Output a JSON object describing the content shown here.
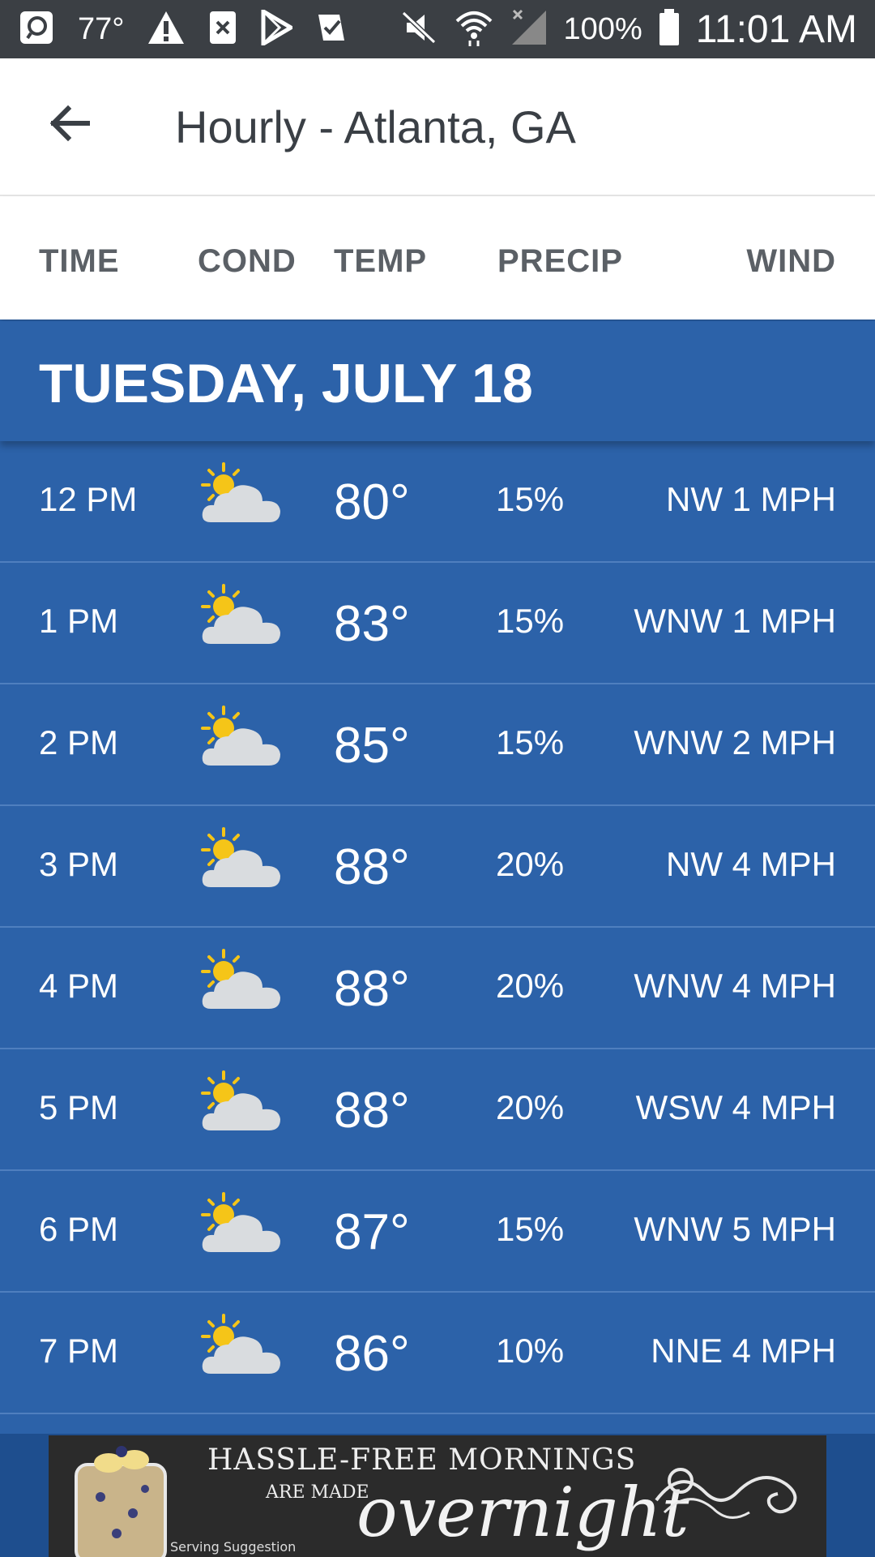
{
  "status_bar": {
    "temperature": "77°",
    "battery": "100%",
    "time": "11:01 AM",
    "icons": [
      "messaging-icon",
      "warning-icon",
      "close-box-icon",
      "play-store-icon",
      "task-check-icon",
      "mute-icon",
      "wifi-icon",
      "signal-icon",
      "battery-icon"
    ]
  },
  "app_bar": {
    "title": "Hourly - Atlanta, GA",
    "back_icon": "arrow-left-icon"
  },
  "columns": {
    "time": "TIME",
    "cond": "COND",
    "temp": "TEMP",
    "precip": "PRECIP",
    "wind": "WIND"
  },
  "day_header": "TUESDAY, JULY 18",
  "rows": [
    {
      "time": "12 PM",
      "cond": "partly-cloudy-icon",
      "temp": "80°",
      "precip": "15%",
      "wind": "NW 1 MPH"
    },
    {
      "time": "1 PM",
      "cond": "partly-cloudy-icon",
      "temp": "83°",
      "precip": "15%",
      "wind": "WNW 1 MPH"
    },
    {
      "time": "2 PM",
      "cond": "partly-cloudy-icon",
      "temp": "85°",
      "precip": "15%",
      "wind": "WNW 2 MPH"
    },
    {
      "time": "3 PM",
      "cond": "partly-cloudy-icon",
      "temp": "88°",
      "precip": "20%",
      "wind": "NW 4 MPH"
    },
    {
      "time": "4 PM",
      "cond": "partly-cloudy-icon",
      "temp": "88°",
      "precip": "20%",
      "wind": "WNW 4 MPH"
    },
    {
      "time": "5 PM",
      "cond": "partly-cloudy-icon",
      "temp": "88°",
      "precip": "20%",
      "wind": "WSW 4 MPH"
    },
    {
      "time": "6 PM",
      "cond": "partly-cloudy-icon",
      "temp": "87°",
      "precip": "15%",
      "wind": "WNW 5 MPH"
    },
    {
      "time": "7 PM",
      "cond": "partly-cloudy-icon",
      "temp": "86°",
      "precip": "10%",
      "wind": "NNE 4 MPH"
    }
  ],
  "ad": {
    "line1": "HASSLE-FREE MORNINGS",
    "line2": "ARE MADE",
    "line3": "overnight",
    "line4": "Serving Suggestion"
  },
  "colors": {
    "row_background": "#2c62a9",
    "row_divider": "#4f7fbf",
    "status_bar": "#3b3f44",
    "sun": "#f5c518"
  }
}
